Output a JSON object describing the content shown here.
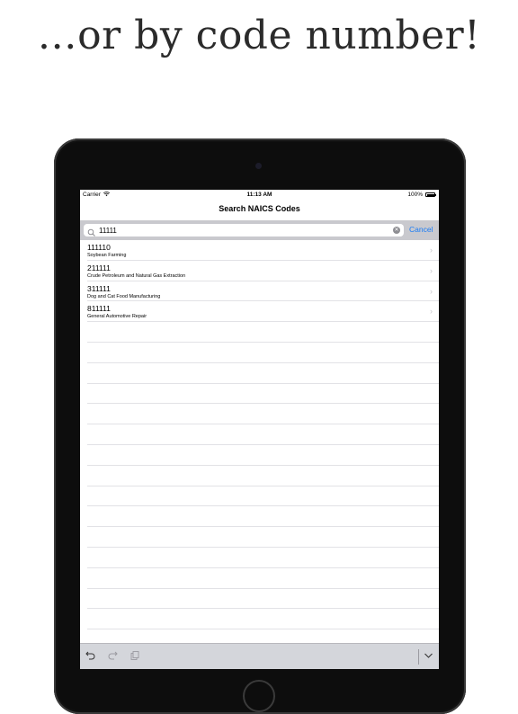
{
  "headline": "…or by code number!",
  "status_bar": {
    "carrier": "Carrier",
    "time": "11:13 AM",
    "battery": "100%"
  },
  "nav": {
    "title": "Search NAICS Codes"
  },
  "search": {
    "value": "11111",
    "cancel_label": "Cancel"
  },
  "results": [
    {
      "code": "111110",
      "description": "Soybean Farming"
    },
    {
      "code": "211111",
      "description": "Crude Petroleum and Natural Gas Extraction"
    },
    {
      "code": "311111",
      "description": "Dog and Cat Food Manufacturing"
    },
    {
      "code": "811111",
      "description": "General Automotive Repair"
    }
  ],
  "icons": {
    "search": "search-icon",
    "clear": "clear-icon",
    "chevron": "chevron-right-icon",
    "undo": "undo-icon",
    "redo": "redo-icon",
    "paste": "paste-icon",
    "dismiss": "chevron-down-icon"
  },
  "colors": {
    "accent": "#1a7cf5",
    "search_bar_bg": "#c9c9ce",
    "toolbar_bg": "#d4d6db"
  }
}
